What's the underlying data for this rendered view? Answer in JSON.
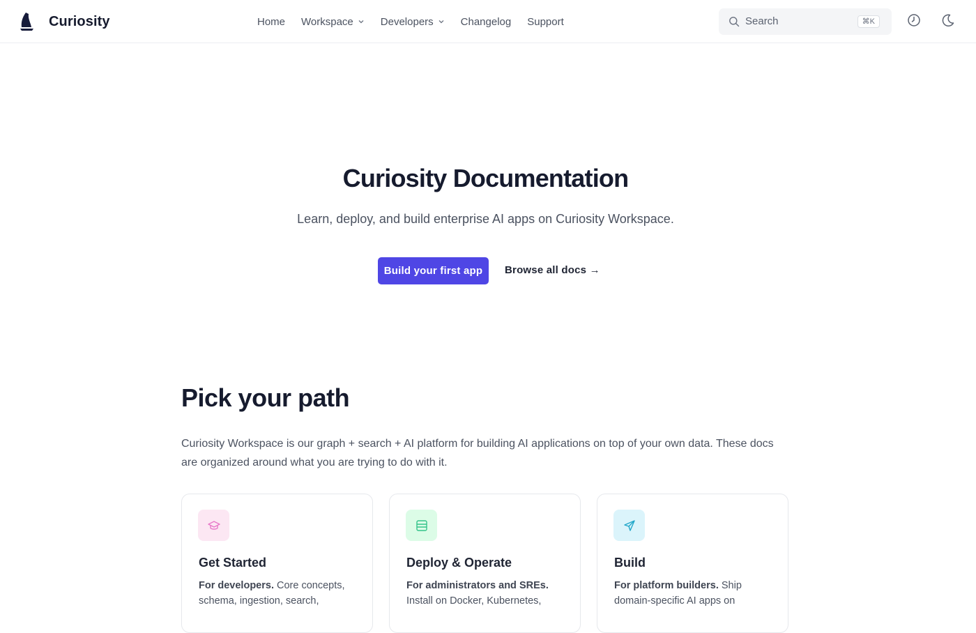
{
  "brand": {
    "name": "Curiosity",
    "logo_icon": "sail-logo-icon"
  },
  "nav": {
    "items": [
      {
        "label": "Home",
        "has_dropdown": false
      },
      {
        "label": "Workspace",
        "has_dropdown": true
      },
      {
        "label": "Developers",
        "has_dropdown": true
      },
      {
        "label": "Changelog",
        "has_dropdown": false
      },
      {
        "label": "Support",
        "has_dropdown": false
      }
    ]
  },
  "search": {
    "placeholder": "Search",
    "shortcut": "⌘K",
    "icon": "search-icon"
  },
  "header_actions": {
    "history_icon": "clock-icon",
    "theme_icon": "moon-icon"
  },
  "hero": {
    "title": "Curiosity Documentation",
    "subtitle": "Learn, deploy, and build enterprise AI apps on Curiosity Workspace.",
    "primary_button": "Build your first app",
    "secondary_link": "Browse all docs →"
  },
  "paths": {
    "title": "Pick your path",
    "intro": "Curiosity Workspace is our graph + search + AI platform for building AI applications on top of your own data. These docs are organized around what you are trying to do with it.",
    "cards": [
      {
        "title": "Get Started",
        "audience": "For developers.",
        "description": " Core concepts, schema, ingestion, search,",
        "icon": "graduation-cap-icon",
        "icon_bg": "#fce7f3",
        "icon_color": "#e879c9"
      },
      {
        "title": "Deploy & Operate",
        "audience": "For administrators and SREs.",
        "description": " Install on Docker, Kubernetes,",
        "icon": "server-icon",
        "icon_bg": "#dcfce7",
        "icon_color": "#34c38a"
      },
      {
        "title": "Build",
        "audience": "For platform builders.",
        "description": " Ship domain-specific AI apps on",
        "icon": "paper-plane-icon",
        "icon_bg": "#dbf4fb",
        "icon_color": "#22a7c9"
      }
    ]
  },
  "colors": {
    "accent": "#4f46e5",
    "heading": "#161b2e",
    "body_text": "#4b5260"
  }
}
